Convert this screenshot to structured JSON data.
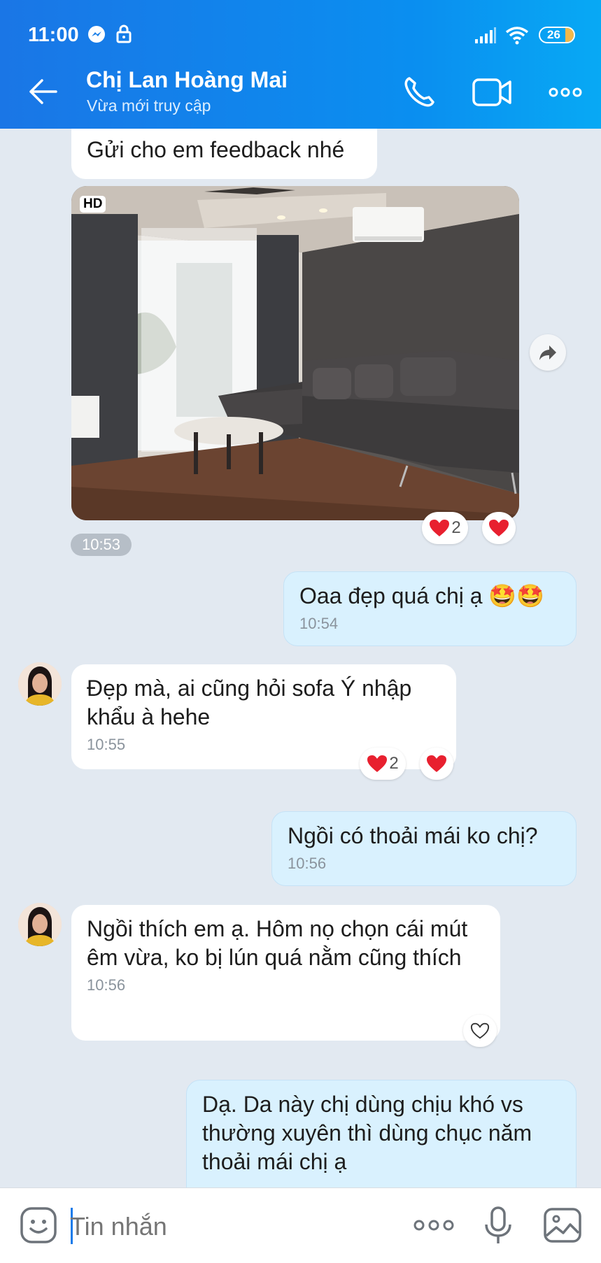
{
  "status": {
    "time": "11:00",
    "battery": "26"
  },
  "header": {
    "contact_name": "Chị Lan Hoàng Mai",
    "presence": "Vừa mới truy cập"
  },
  "messages": {
    "m1_text": "Gửi cho em feedback nhé",
    "photo_badge": "HD",
    "photo_time": "10:53",
    "photo_reaction_count": "2",
    "m2_text": "Oaa đẹp quá chị ạ 🤩🤩",
    "m2_time": "10:54",
    "m3_text": "Đẹp mà, ai cũng hỏi sofa Ý nhập khẩu à hehe",
    "m3_time": "10:55",
    "m3_reaction_count": "2",
    "m4_text": "Ngồi có thoải mái ko chị?",
    "m4_time": "10:56",
    "m5_text": "Ngồi thích em ạ. Hôm nọ chọn cái mút êm vừa, ko bị lún quá nằm cũng thích",
    "m5_time": "10:56",
    "m6_text": "Dạ. Da này chị dùng chịu khó vs thường xuyên thì dùng chục năm thoải mái chị ạ"
  },
  "composer": {
    "placeholder": "Tin nhắn"
  },
  "colors": {
    "header_start": "#1a76e6",
    "header_end": "#08a9f4",
    "chat_bg": "#e2e9f1",
    "outgoing_bubble": "#d9f1fe",
    "heart": "#e8202f"
  },
  "icons": [
    "messenger-icon",
    "lock-icon",
    "signal-icon",
    "wifi-icon",
    "battery-icon",
    "back-arrow-icon",
    "phone-icon",
    "video-icon",
    "more-icon",
    "share-icon",
    "heart-icon",
    "sticker-icon",
    "mic-icon",
    "image-icon"
  ]
}
